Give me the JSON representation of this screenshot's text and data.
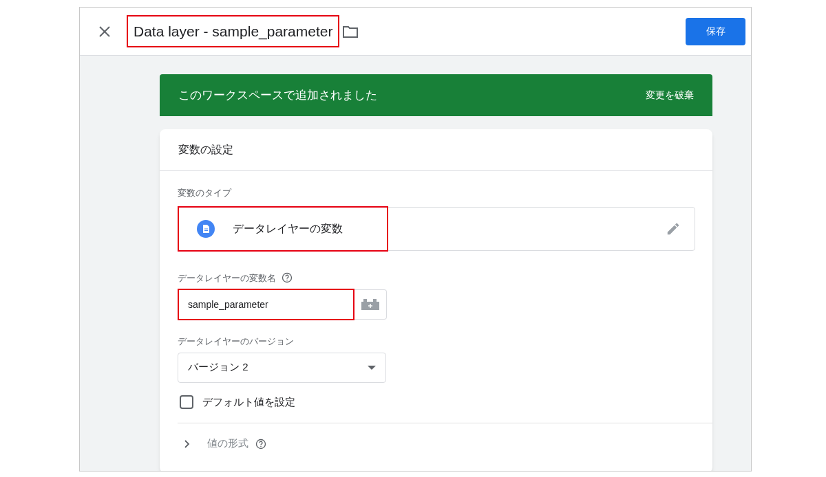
{
  "header": {
    "title": "Data layer - sample_parameter",
    "title_highlighted": true,
    "save_button": "保存"
  },
  "banner": {
    "message": "このワークスペースで追加されました",
    "action": "変更を破棄"
  },
  "card": {
    "title": "変数の設定",
    "variable_type": {
      "label": "変数のタイプ",
      "value": "データレイヤーの変数",
      "highlighted": true
    },
    "variable_name": {
      "label": "データレイヤーの変数名",
      "value": "sample_parameter",
      "highlighted": true
    },
    "version": {
      "label": "データレイヤーのバージョン",
      "value": "バージョン 2"
    },
    "default_value": {
      "label": "デフォルト値を設定",
      "checked": false
    },
    "value_format": {
      "label": "値の形式",
      "expanded": false
    }
  }
}
